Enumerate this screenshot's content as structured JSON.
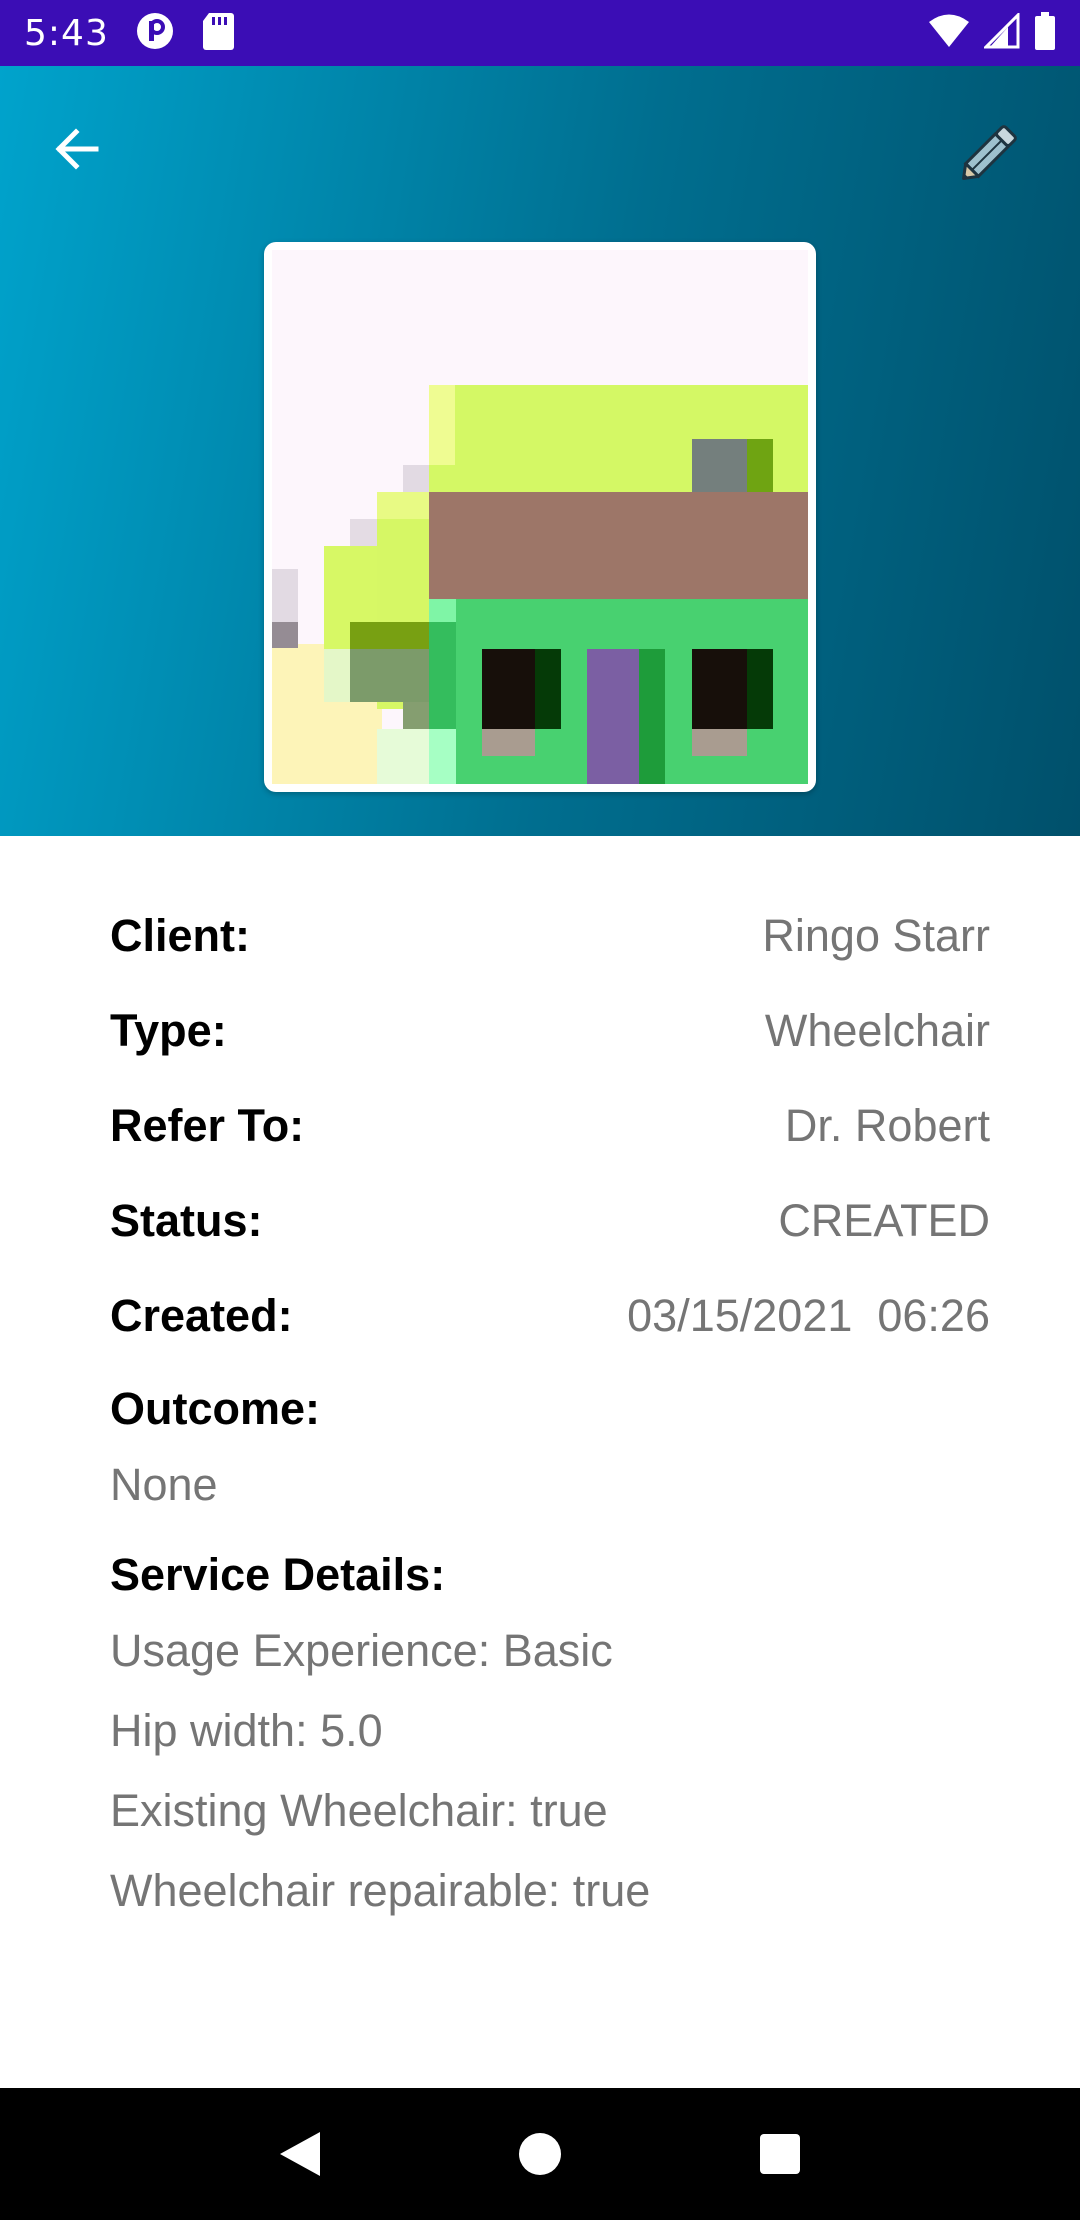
{
  "status_bar": {
    "time": "5:43",
    "icons_left": [
      "notification-p-icon",
      "sd-card-icon"
    ],
    "icons_right": [
      "wifi-icon",
      "signal-icon",
      "battery-icon"
    ],
    "color": "#3B0DB5"
  },
  "header": {
    "back_icon": "arrow-back-icon",
    "edit_icon": "pencil-icon",
    "gradient": [
      "#00A3CC",
      "#00506B"
    ]
  },
  "details": {
    "rows": [
      {
        "label": "Client:",
        "value": "Ringo Starr"
      },
      {
        "label": "Type:",
        "value": "Wheelchair"
      },
      {
        "label": "Refer To:",
        "value": "Dr. Robert"
      },
      {
        "label": "Status:",
        "value": "CREATED"
      },
      {
        "label": "Created:",
        "value": "03/15/2021  06:26"
      }
    ],
    "outcome": {
      "label": "Outcome:",
      "value": "None"
    },
    "service": {
      "label": "Service Details:",
      "lines": [
        "Usage Experience: Basic",
        "Hip width: 5.0",
        "Existing Wheelchair: true",
        "Wheelchair repairable: true"
      ]
    }
  },
  "nav_bar": {
    "buttons": [
      "back-triangle",
      "home-circle",
      "recents-square"
    ]
  }
}
